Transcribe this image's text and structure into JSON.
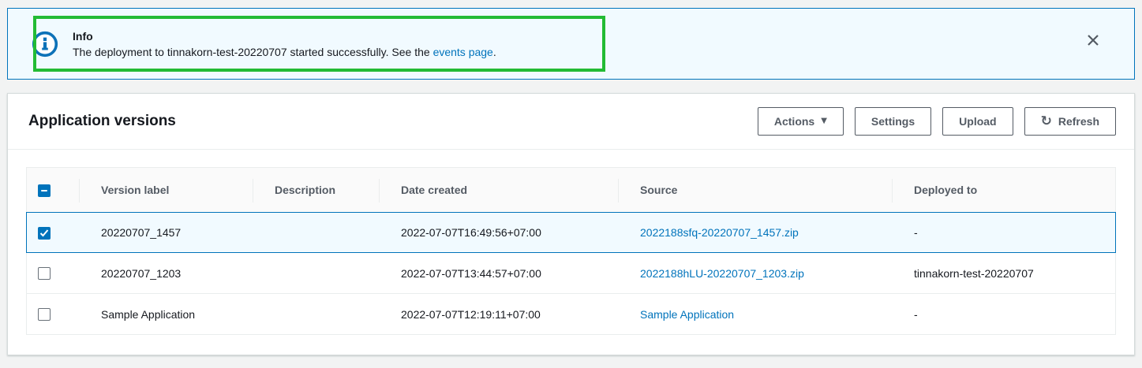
{
  "banner": {
    "title": "Info",
    "message_prefix": "The deployment to tinnakorn-test-20220707 started successfully. See the ",
    "link_text": "events page",
    "message_suffix": "."
  },
  "panel": {
    "title": "Application versions",
    "buttons": {
      "actions": "Actions",
      "settings": "Settings",
      "upload": "Upload",
      "refresh": "Refresh"
    }
  },
  "table": {
    "select_all_state": "indeterminate",
    "columns": [
      "Version label",
      "Description",
      "Date created",
      "Source",
      "Deployed to"
    ],
    "rows": [
      {
        "selected": true,
        "checkbox": "checked",
        "version_label": "20220707_1457",
        "description": "",
        "date_created": "2022-07-07T16:49:56+07:00",
        "source": "2022188sfq-20220707_1457.zip",
        "deployed_to": "-"
      },
      {
        "selected": false,
        "checkbox": "unchecked",
        "version_label": "20220707_1203",
        "description": "",
        "date_created": "2022-07-07T13:44:57+07:00",
        "source": "2022188hLU-20220707_1203.zip",
        "deployed_to": "tinnakorn-test-20220707"
      },
      {
        "selected": false,
        "checkbox": "unchecked",
        "version_label": "Sample Application",
        "description": "",
        "date_created": "2022-07-07T12:19:11+07:00",
        "source": "Sample Application",
        "deployed_to": "-"
      }
    ]
  },
  "colors": {
    "accent_blue": "#0073bb",
    "banner_background": "#f1faff",
    "annotation_green": "#23bb34",
    "button_gray": "#545b64",
    "table_border": "#eaeded",
    "selected_row_background": "#f1faff",
    "page_background": "#f2f3f3"
  }
}
